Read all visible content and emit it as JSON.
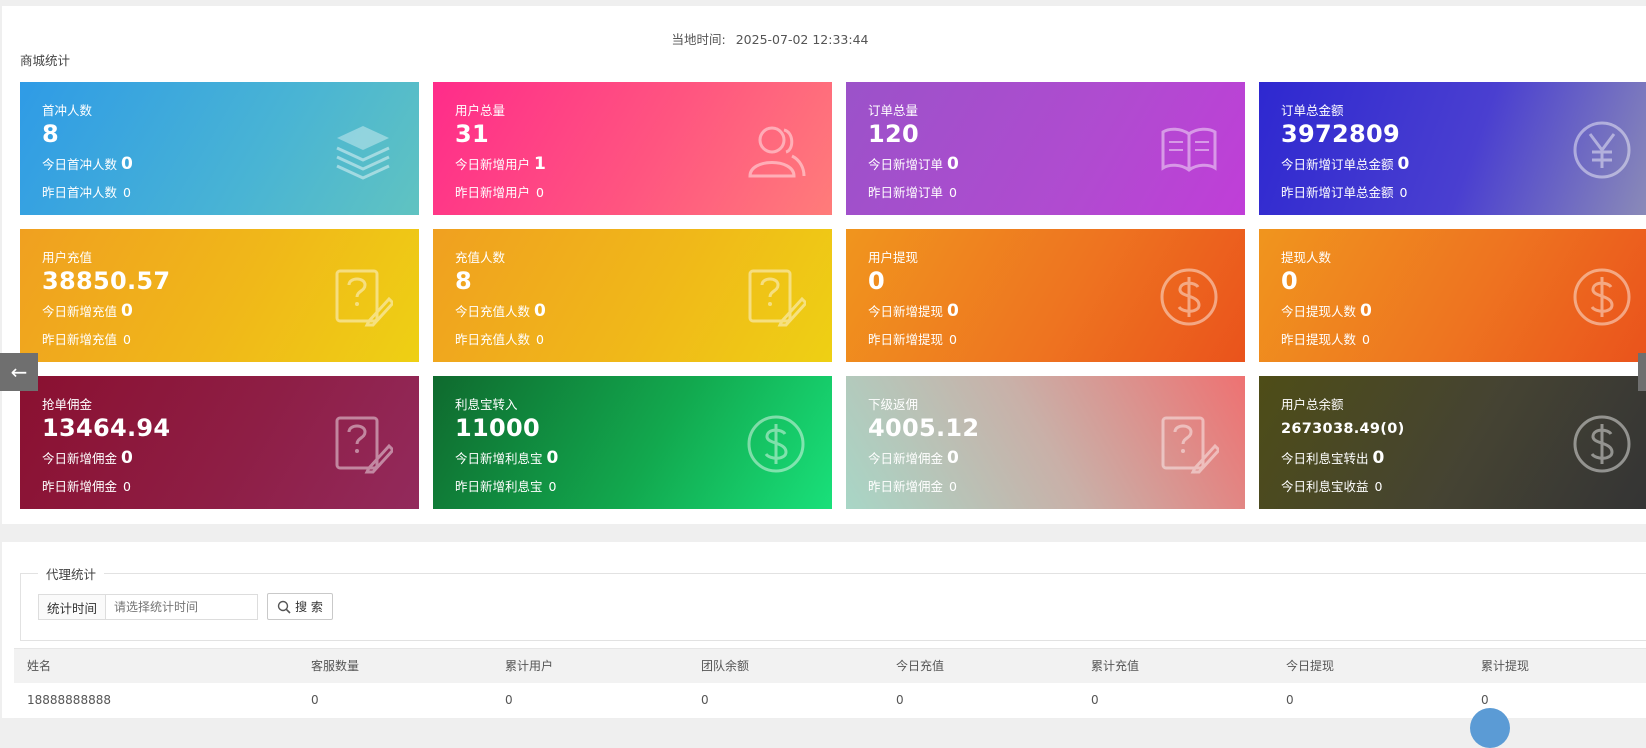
{
  "header": {
    "local_time_label": "当地时间:",
    "local_time_value": "2025-07-02 12:33:44",
    "section_title": "商城统计"
  },
  "colors": {
    "card_first_recharge": "#3aa3e3",
    "card_total_users": "#ff3a8c",
    "card_total_orders": "#a552c8",
    "card_order_amount": "#3a2fd0",
    "card_user_recharge": "#f0a020",
    "card_recharge_users": "#f0a020",
    "card_user_withdraw": "#ee5a20",
    "card_withdraw_users": "#ee5a20",
    "card_grab_commission": "#8e1a3a",
    "card_interest_in": "#14a84e",
    "card_sub_rebate": "#c9b0a8",
    "card_total_balance": "#4b4a1e"
  },
  "cards": [
    {
      "title": "首冲人数",
      "value": "8",
      "row1_label": "今日首冲人数",
      "row1_value": "0",
      "row2_label": "昨日首冲人数",
      "row2_value": "0",
      "icon": "layers-icon"
    },
    {
      "title": "用户总量",
      "value": "31",
      "row1_label": "今日新增用户",
      "row1_value": "1",
      "row2_label": "昨日新增用户",
      "row2_value": "0",
      "icon": "users-icon"
    },
    {
      "title": "订单总量",
      "value": "120",
      "row1_label": "今日新增订单",
      "row1_value": "0",
      "row2_label": "昨日新增订单",
      "row2_value": "0",
      "icon": "book-icon"
    },
    {
      "title": "订单总金额",
      "value": "3972809",
      "row1_label": "今日新增订单总金额",
      "row1_value": "0",
      "row2_label": "昨日新增订单总金额",
      "row2_value": "0",
      "icon": "yen-icon"
    },
    {
      "title": "用户充值",
      "value": "38850.57",
      "row1_label": "今日新增充值",
      "row1_value": "0",
      "row2_label": "昨日新增充值",
      "row2_value": "0",
      "icon": "question-edit-icon"
    },
    {
      "title": "充值人数",
      "value": "8",
      "row1_label": "今日充值人数",
      "row1_value": "0",
      "row2_label": "昨日充值人数",
      "row2_value": "0",
      "icon": "question-edit-icon"
    },
    {
      "title": "用户提现",
      "value": "0",
      "row1_label": "今日新增提现",
      "row1_value": "0",
      "row2_label": "昨日新增提现",
      "row2_value": "0",
      "icon": "dollar-icon"
    },
    {
      "title": "提现人数",
      "value": "0",
      "row1_label": "今日提现人数",
      "row1_value": "0",
      "row2_label": "昨日提现人数",
      "row2_value": "0",
      "icon": "dollar-icon"
    },
    {
      "title": "抢单佣金",
      "value": "13464.94",
      "row1_label": "今日新增佣金",
      "row1_value": "0",
      "row2_label": "昨日新增佣金",
      "row2_value": "0",
      "icon": "question-edit-icon"
    },
    {
      "title": "利息宝转入",
      "value": "11000",
      "row1_label": "今日新增利息宝",
      "row1_value": "0",
      "row2_label": "昨日新增利息宝",
      "row2_value": "0",
      "icon": "dollar-icon"
    },
    {
      "title": "下级返佣",
      "value": "4005.12",
      "row1_label": "今日新增佣金",
      "row1_value": "0",
      "row2_label": "昨日新增佣金",
      "row2_value": "0",
      "icon": "question-edit-icon"
    },
    {
      "title": "用户总余额",
      "value": "2673038.49(0)",
      "row1_label": "今日利息宝转出",
      "row1_value": "0",
      "row2_label": "今日利息宝收益",
      "row2_value": "0",
      "icon": "dollar-icon"
    }
  ],
  "nav": {
    "prev_arrow": "←"
  },
  "agent": {
    "legend": "代理统计",
    "filter_label": "统计时间",
    "filter_placeholder": "请选择统计时间",
    "search_label": "搜 索",
    "columns": [
      "姓名",
      "客服数量",
      "累计用户",
      "团队余额",
      "今日充值",
      "累计充值",
      "今日提现",
      "累计提现"
    ],
    "rows": [
      [
        "18888888888",
        "0",
        "0",
        "0",
        "0",
        "0",
        "0",
        "0"
      ]
    ]
  }
}
